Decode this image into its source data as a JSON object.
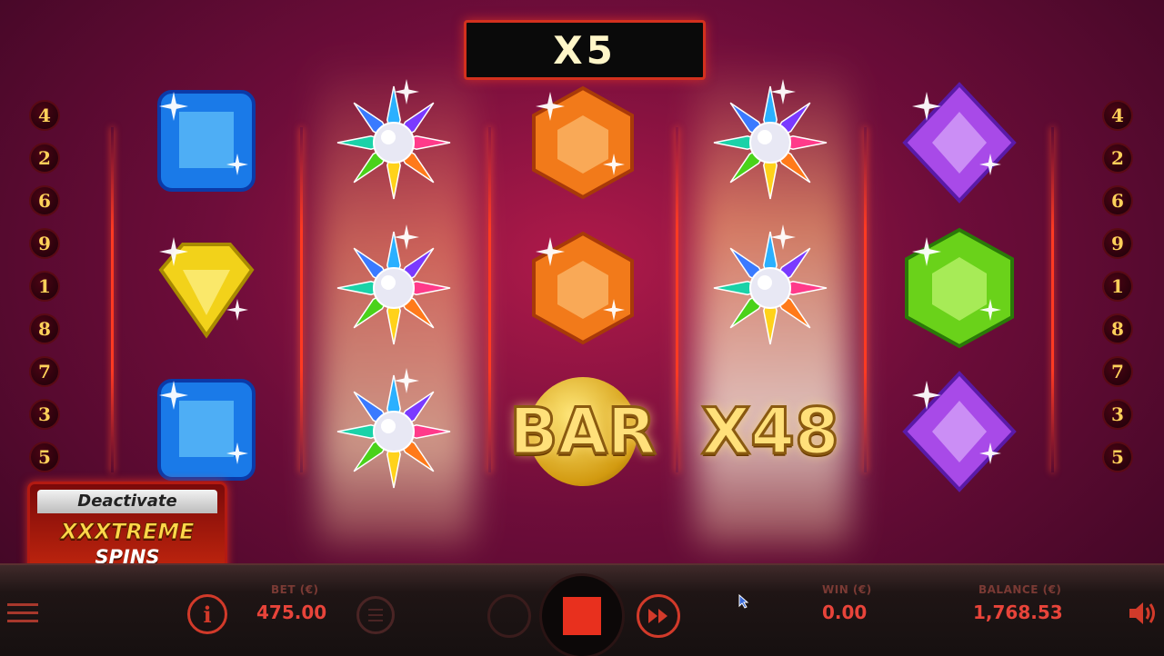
{
  "game": {
    "multiplier_banner": "X5",
    "paylines_left": [
      "4",
      "2",
      "6",
      "9",
      "1",
      "8",
      "7",
      "3",
      "5"
    ],
    "paylines_right": [
      "4",
      "2",
      "6",
      "9",
      "1",
      "8",
      "7",
      "3",
      "5"
    ],
    "reels": [
      [
        "blue-gem",
        "yellow-gem",
        "blue-gem"
      ],
      [
        "wild-star",
        "wild-star",
        "wild-star"
      ],
      [
        "orange-gem",
        "orange-gem",
        "bar"
      ],
      [
        "wild-star",
        "wild-star",
        "multiplier"
      ],
      [
        "purple-gem",
        "green-gem",
        "purple-gem"
      ]
    ],
    "bar_symbol_text": "BAR",
    "multiplier_symbol_text": "X48",
    "colors": {
      "accent": "#d23a2a",
      "gold": "#ffd84a",
      "background": "#6e0d3a"
    }
  },
  "xtreme_button": {
    "line1": "Deactivate",
    "line2": "XXXTREME",
    "line3": "SPINS"
  },
  "bottom_bar": {
    "bet_label": "BET (€)",
    "bet_value": "475.00",
    "win_label": "WIN (€)",
    "win_value": "0.00",
    "balance_label": "BALANCE (€)",
    "balance_value": "1,768.53",
    "icons": [
      "menu-icon",
      "info-icon",
      "paytable-icon",
      "autoplay-icon",
      "stop-icon",
      "fast-forward-icon",
      "sound-icon"
    ]
  }
}
